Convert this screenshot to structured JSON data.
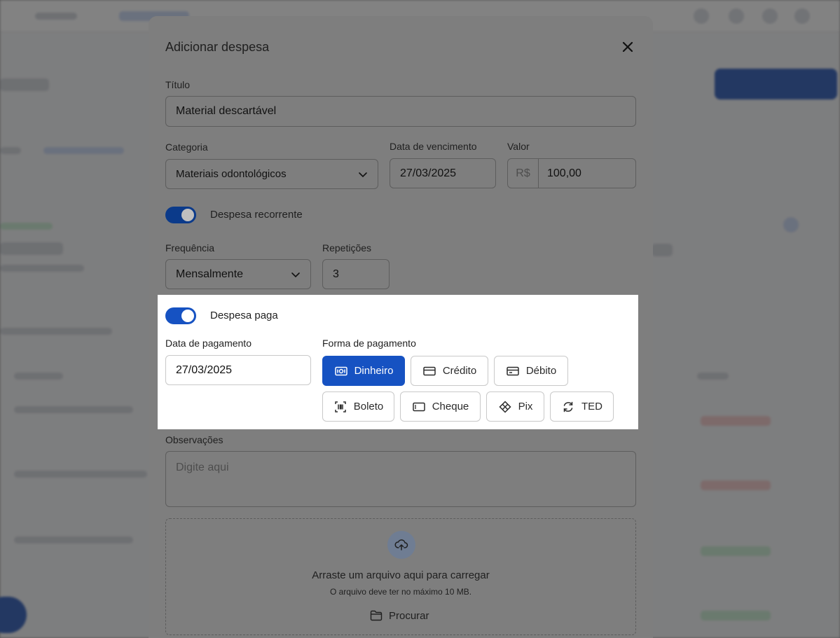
{
  "modal": {
    "title": "Adicionar despesa",
    "titulo_label": "Título",
    "titulo_value": "Material descartável",
    "categoria_label": "Categoria",
    "categoria_value": "Materiais odontológicos",
    "vencimento_label": "Data de vencimento",
    "vencimento_value": "27/03/2025",
    "valor_label": "Valor",
    "valor_prefix": "R$",
    "valor_value": "100,00",
    "recorrente_label": "Despesa recorrente",
    "recorrente_on": true,
    "frequencia_label": "Frequência",
    "frequencia_value": "Mensalmente",
    "repeticoes_label": "Repetições",
    "repeticoes_value": "3",
    "paga_label": "Despesa paga",
    "paga_on": true,
    "pagamento_data_label": "Data de pagamento",
    "pagamento_data_value": "27/03/2025",
    "forma_label": "Forma de pagamento",
    "formas": [
      {
        "label": "Dinheiro",
        "icon": "cash-icon",
        "active": true
      },
      {
        "label": "Crédito",
        "icon": "credit-card-icon",
        "active": false
      },
      {
        "label": "Débito",
        "icon": "debit-card-icon",
        "active": false
      },
      {
        "label": "Boleto",
        "icon": "barcode-icon",
        "active": false
      },
      {
        "label": "Cheque",
        "icon": "cheque-icon",
        "active": false
      },
      {
        "label": "Pix",
        "icon": "pix-icon",
        "active": false
      },
      {
        "label": "TED",
        "icon": "refresh-icon",
        "active": false
      }
    ],
    "observacoes_label": "Observações",
    "observacoes_placeholder": "Digite aqui",
    "dropzone_main": "Arraste um arquivo aqui para carregar",
    "dropzone_sub": "O arquivo deve ter no máximo 10 MB.",
    "procurar_label": "Procurar"
  },
  "colors": {
    "accent": "#1652c2",
    "overlay": "rgba(40,40,40,0.58)"
  }
}
